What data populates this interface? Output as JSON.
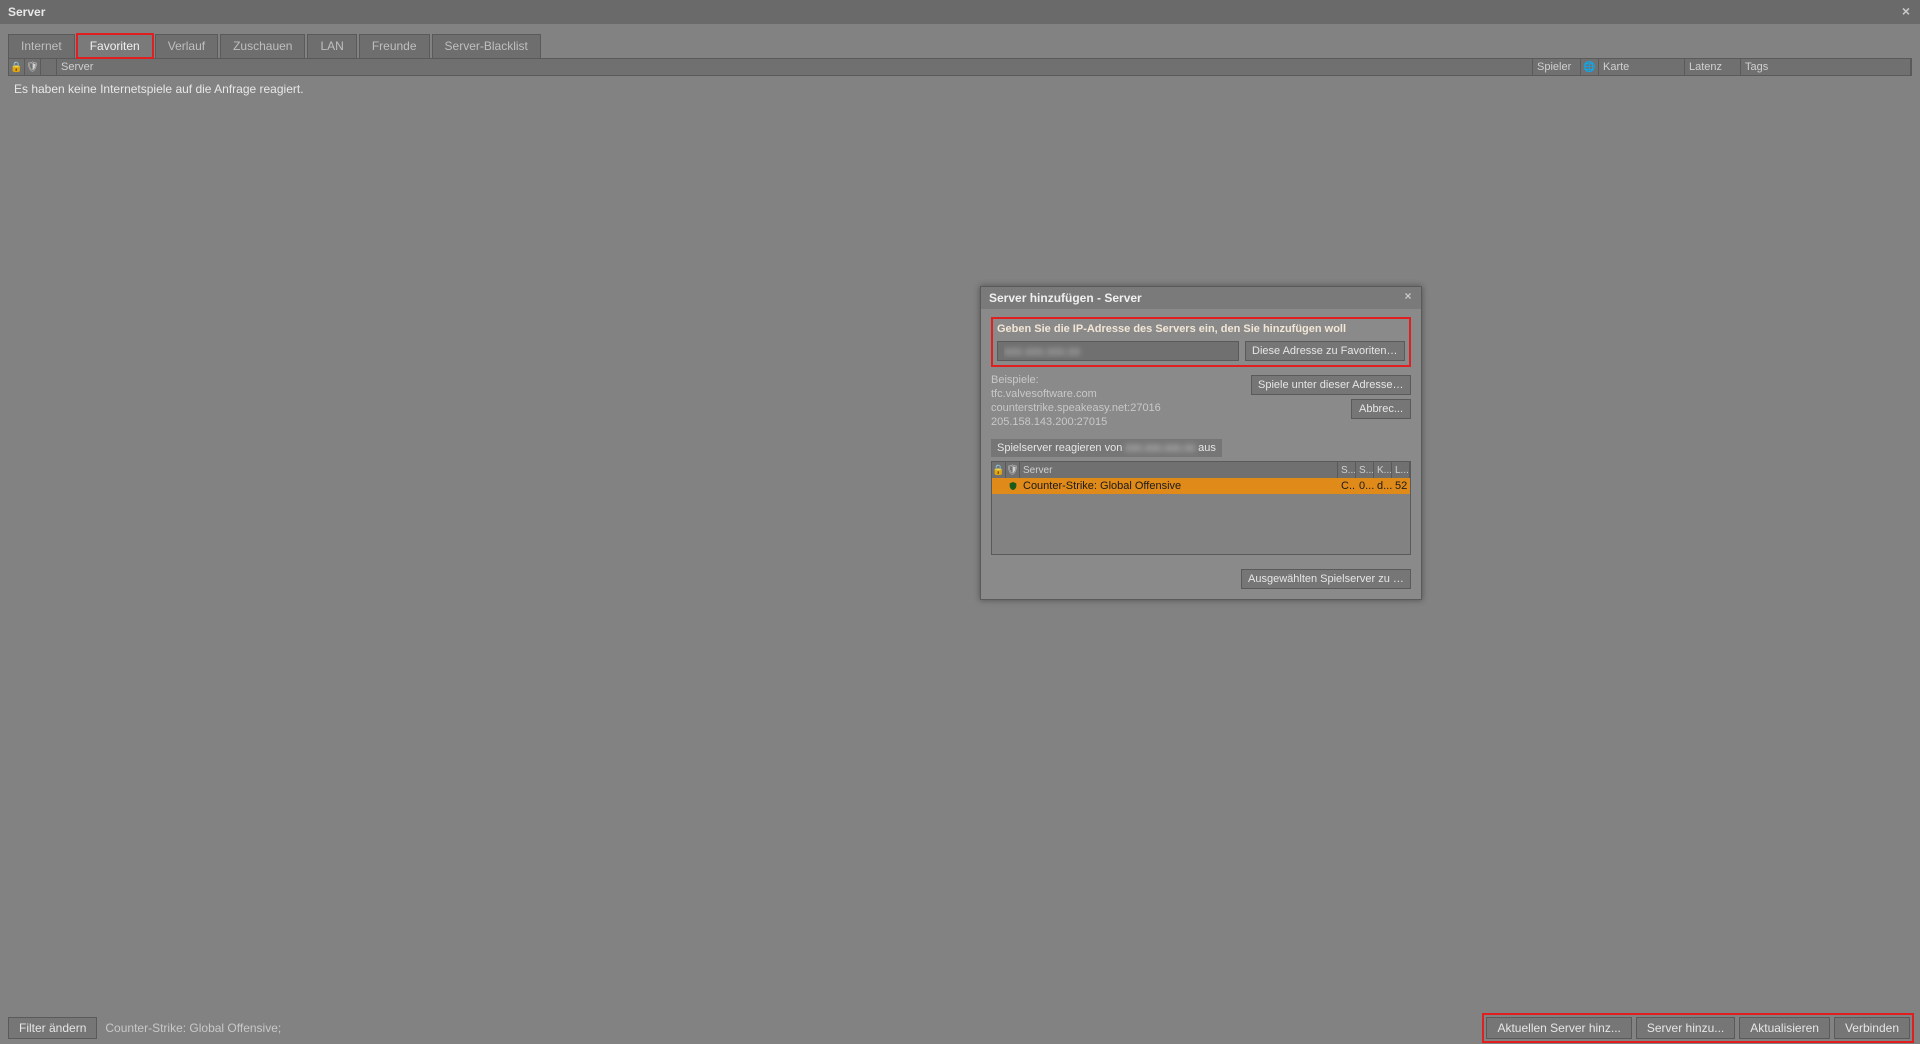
{
  "window": {
    "title": "Server"
  },
  "tabs": [
    {
      "id": "internet",
      "label": "Internet"
    },
    {
      "id": "favoriten",
      "label": "Favoriten"
    },
    {
      "id": "verlauf",
      "label": "Verlauf"
    },
    {
      "id": "zuschauen",
      "label": "Zuschauen"
    },
    {
      "id": "lan",
      "label": "LAN"
    },
    {
      "id": "freunde",
      "label": "Freunde"
    },
    {
      "id": "blacklist",
      "label": "Server-Blacklist"
    }
  ],
  "columns": {
    "server": "Server",
    "spieler": "Spieler",
    "karte": "Karte",
    "latenz": "Latenz",
    "tags": "Tags"
  },
  "emptyMessage": "Es haben keine Internetspiele auf die Anfrage reagiert.",
  "bottom": {
    "filter": "Filter ändern",
    "status": "Counter-Strike: Global Offensive;",
    "btn_current": "Aktuellen Server hinz...",
    "btn_add": "Server hinzu...",
    "btn_refresh": "Aktualisieren",
    "btn_connect": "Verbinden"
  },
  "dialog": {
    "title": "Server hinzufügen - Server",
    "instruction": "Geben Sie die IP-Adresse des Servers ein, den Sie hinzufügen woll",
    "ip_value": "xxx.xxx.xxx.xx",
    "btn_addfav": "Diese Adresse zu Favoriten hi...",
    "btn_findgames": "Spiele unter dieser Adresse s...",
    "btn_cancel": "Abbrec...",
    "examples_label": "Beispiele:",
    "example1": "tfc.valvesoftware.com",
    "example2": "counterstrike.speakeasy.net:27016",
    "example3": "205.158.143.200:27015",
    "respond_prefix": "Spielserver reagieren von ",
    "respond_ip": "xxx.xxx.xxx.xx",
    "respond_suffix": " aus",
    "inner_columns": {
      "server": "Server",
      "s": "S...",
      "s2": "S...",
      "k": "K...",
      "l": "L..."
    },
    "row": {
      "name": "Counter-Strike: Global Offensive",
      "s": "C...",
      "s2": "0...",
      "k": "d...",
      "l": "52"
    },
    "btn_selected": "Ausgewählten Spielserver zu Fav..."
  }
}
